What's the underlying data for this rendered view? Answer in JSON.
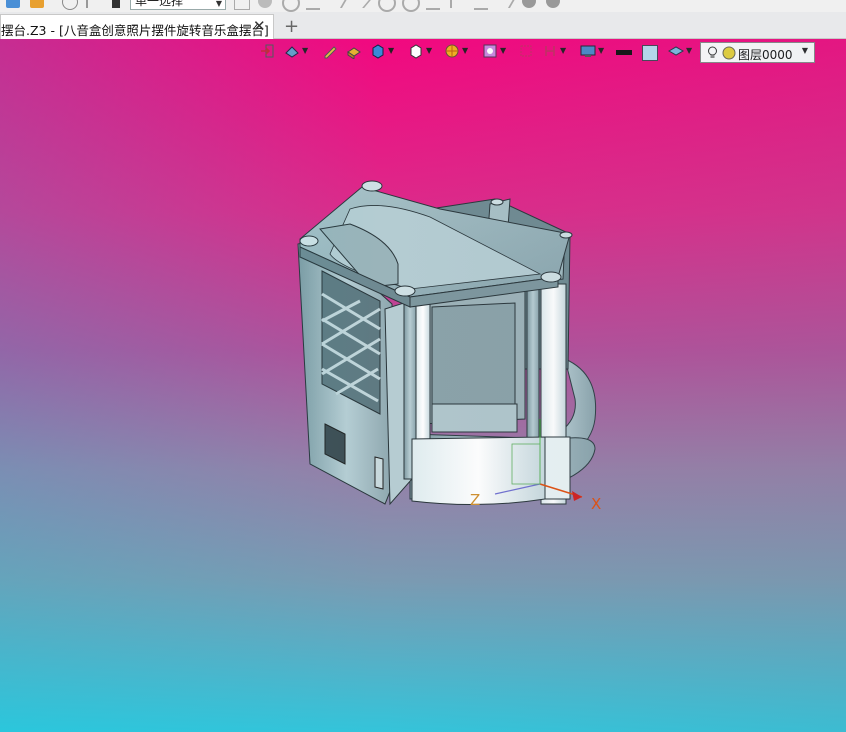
{
  "toolbar": {
    "selection_mode": "单一选择"
  },
  "tabs": {
    "document_title": "摆台.Z3 - [八音盒创意照片摆件旋转音乐盒摆台]",
    "close_symbol": "✕",
    "add_symbol": "+"
  },
  "view_toolbar": {
    "layer_name": "图层0000",
    "icons": [
      "exit-sketch-icon",
      "view-orient-icon",
      "pencil-icon",
      "box-shaded-icon",
      "cube-blue-icon",
      "cube-white-icon",
      "section-icon",
      "zoom-icon",
      "frame-icon",
      "bracket-icon",
      "monitor-icon",
      "color-black-swatch",
      "color-blue-swatch",
      "layer-stack-icon",
      "bulb-icon",
      "layer-status-icon"
    ]
  },
  "viewport": {
    "axis_x_label": "X",
    "axis_z_label": "Z",
    "background_top": "#f2087f",
    "background_bottom": "#34c4da"
  }
}
